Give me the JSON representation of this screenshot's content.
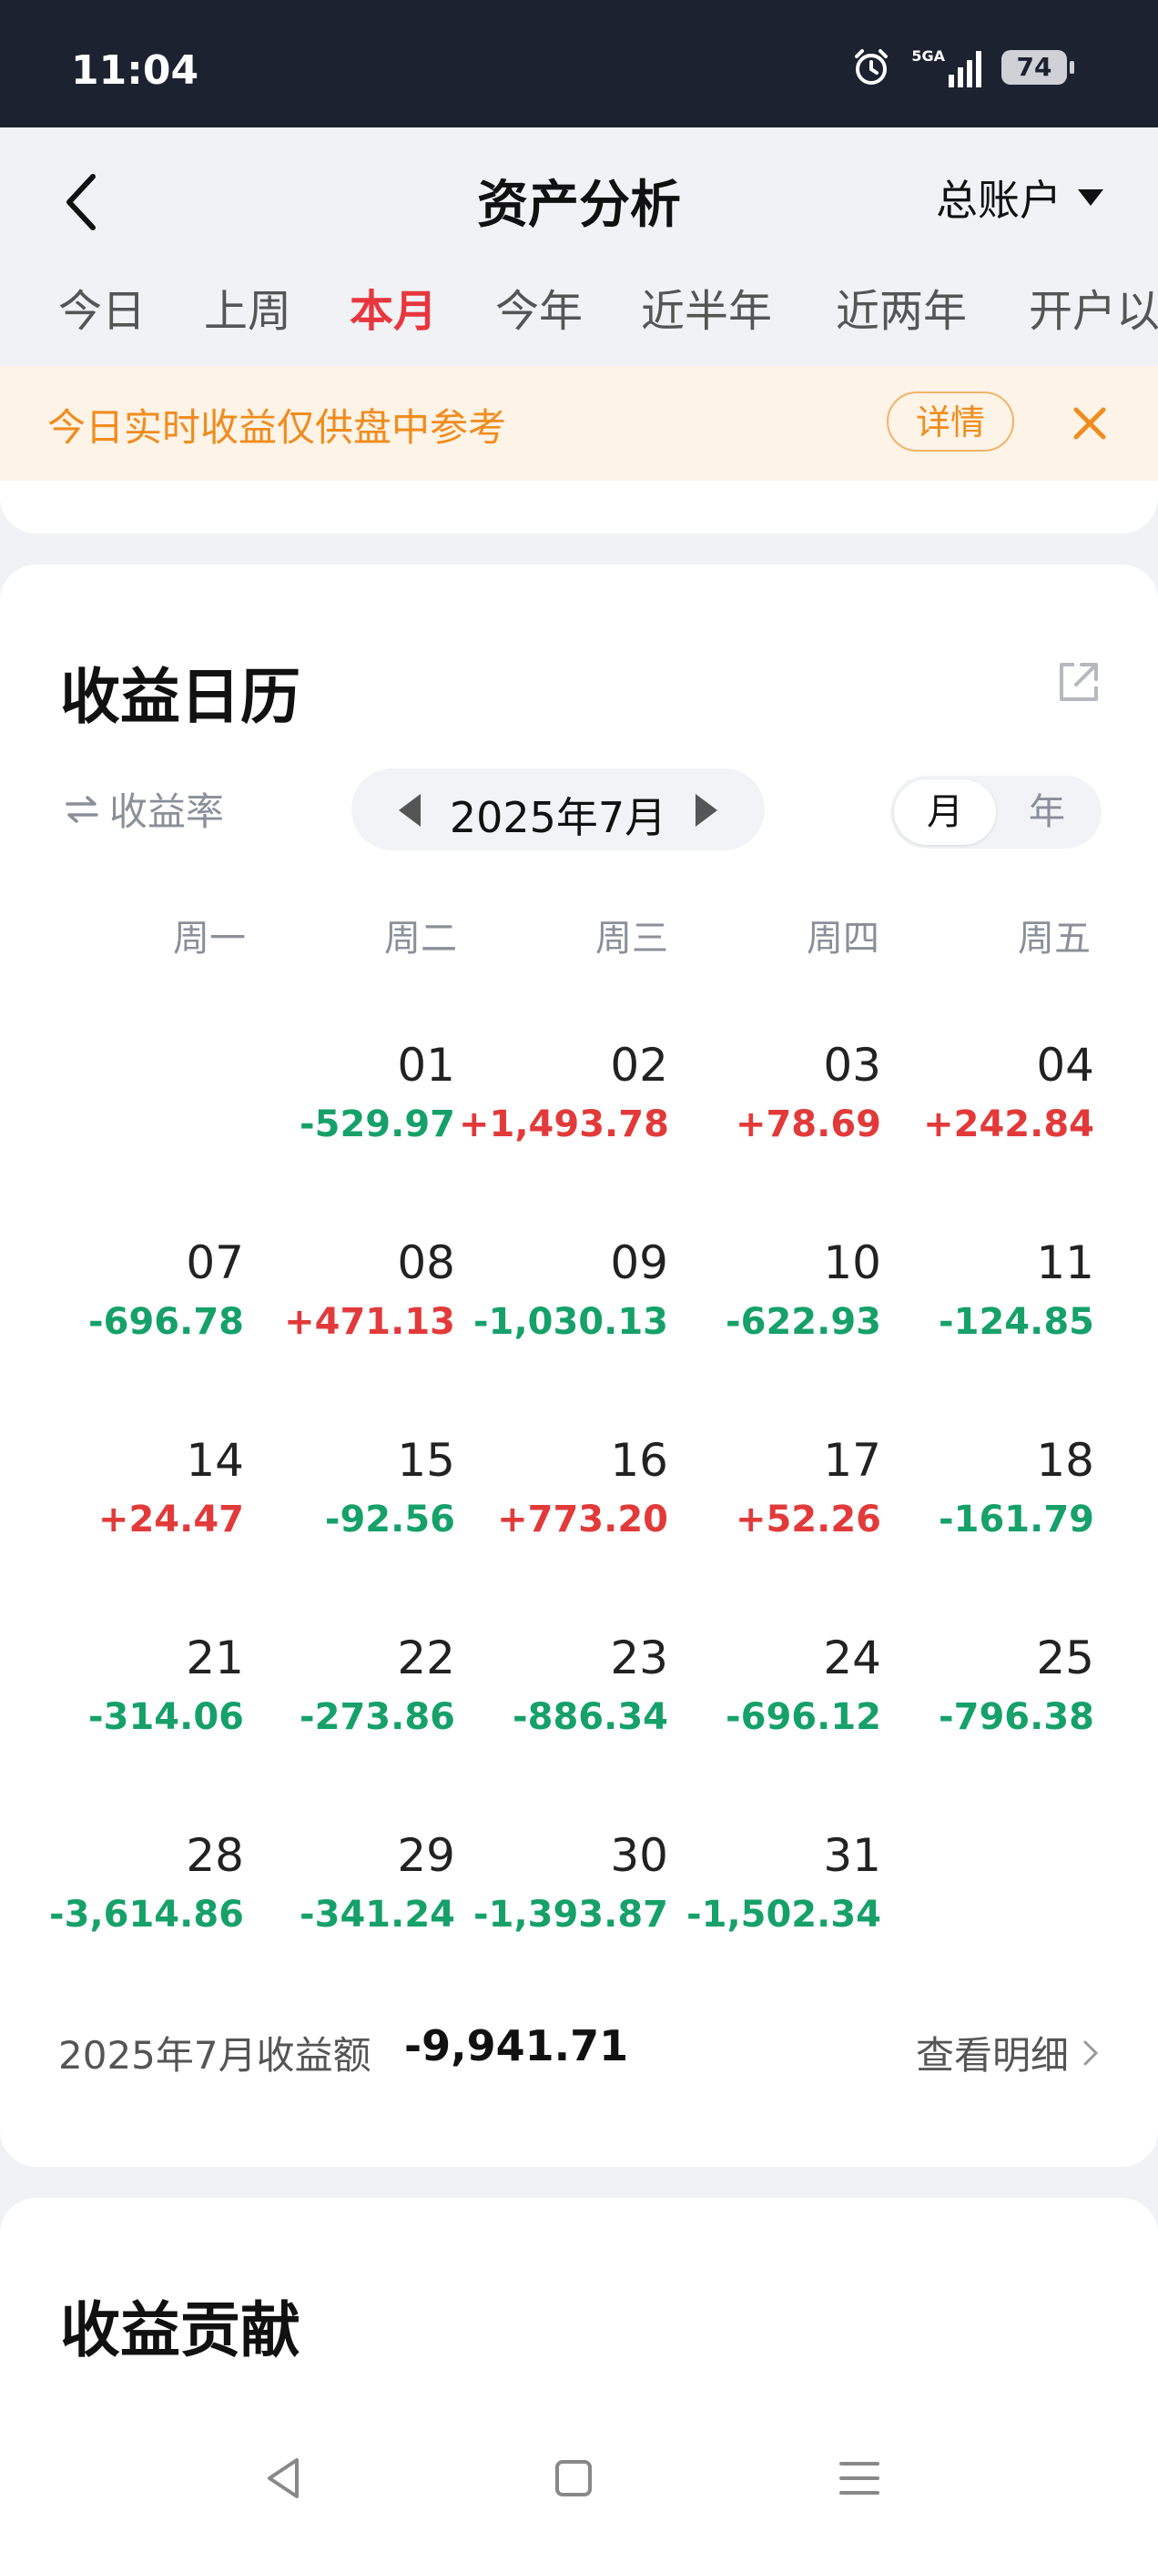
{
  "status": {
    "time": "11:04",
    "signal": "5GA",
    "battery": "74"
  },
  "header": {
    "title": "资产分析",
    "account": "总账户"
  },
  "tabs": [
    {
      "label": "今日"
    },
    {
      "label": "上周"
    },
    {
      "label": "本月",
      "active": true
    },
    {
      "label": "今年"
    },
    {
      "label": "近半年"
    },
    {
      "label": "近两年"
    },
    {
      "label": "开户以"
    }
  ],
  "notice": {
    "text": "今日实时收益仅供盘中参考",
    "button": "详情"
  },
  "calendar": {
    "title": "收益日历",
    "rate_toggle": "收益率",
    "month_label": "2025年7月",
    "seg_month": "月",
    "seg_year": "年",
    "weekdays": [
      "周一",
      "周二",
      "周三",
      "周四",
      "周五"
    ],
    "weeks": [
      [
        null,
        {
          "day": "01",
          "value": "-529.97"
        },
        {
          "day": "02",
          "value": "+1,493.78"
        },
        {
          "day": "03",
          "value": "+78.69"
        },
        {
          "day": "04",
          "value": "+242.84"
        }
      ],
      [
        {
          "day": "07",
          "value": "-696.78"
        },
        {
          "day": "08",
          "value": "+471.13"
        },
        {
          "day": "09",
          "value": "-1,030.13"
        },
        {
          "day": "10",
          "value": "-622.93"
        },
        {
          "day": "11",
          "value": "-124.85"
        }
      ],
      [
        {
          "day": "14",
          "value": "+24.47"
        },
        {
          "day": "15",
          "value": "-92.56"
        },
        {
          "day": "16",
          "value": "+773.20"
        },
        {
          "day": "17",
          "value": "+52.26"
        },
        {
          "day": "18",
          "value": "-161.79"
        }
      ],
      [
        {
          "day": "21",
          "value": "-314.06"
        },
        {
          "day": "22",
          "value": "-273.86"
        },
        {
          "day": "23",
          "value": "-886.34"
        },
        {
          "day": "24",
          "value": "-696.12"
        },
        {
          "day": "25",
          "value": "-796.38"
        }
      ],
      [
        {
          "day": "28",
          "value": "-3,614.86"
        },
        {
          "day": "29",
          "value": "-341.24"
        },
        {
          "day": "30",
          "value": "-1,393.87"
        },
        {
          "day": "31",
          "value": "-1,502.34"
        },
        null
      ]
    ],
    "summary_label": "2025年7月收益额",
    "summary_value": "-9,941.71",
    "detail_link": "查看明细"
  },
  "contribution": {
    "title": "收益贡献"
  },
  "colors": {
    "positive": "#e23a3a",
    "negative": "#16a06a",
    "accent": "#e8363d",
    "notice": "#f08c1e"
  }
}
